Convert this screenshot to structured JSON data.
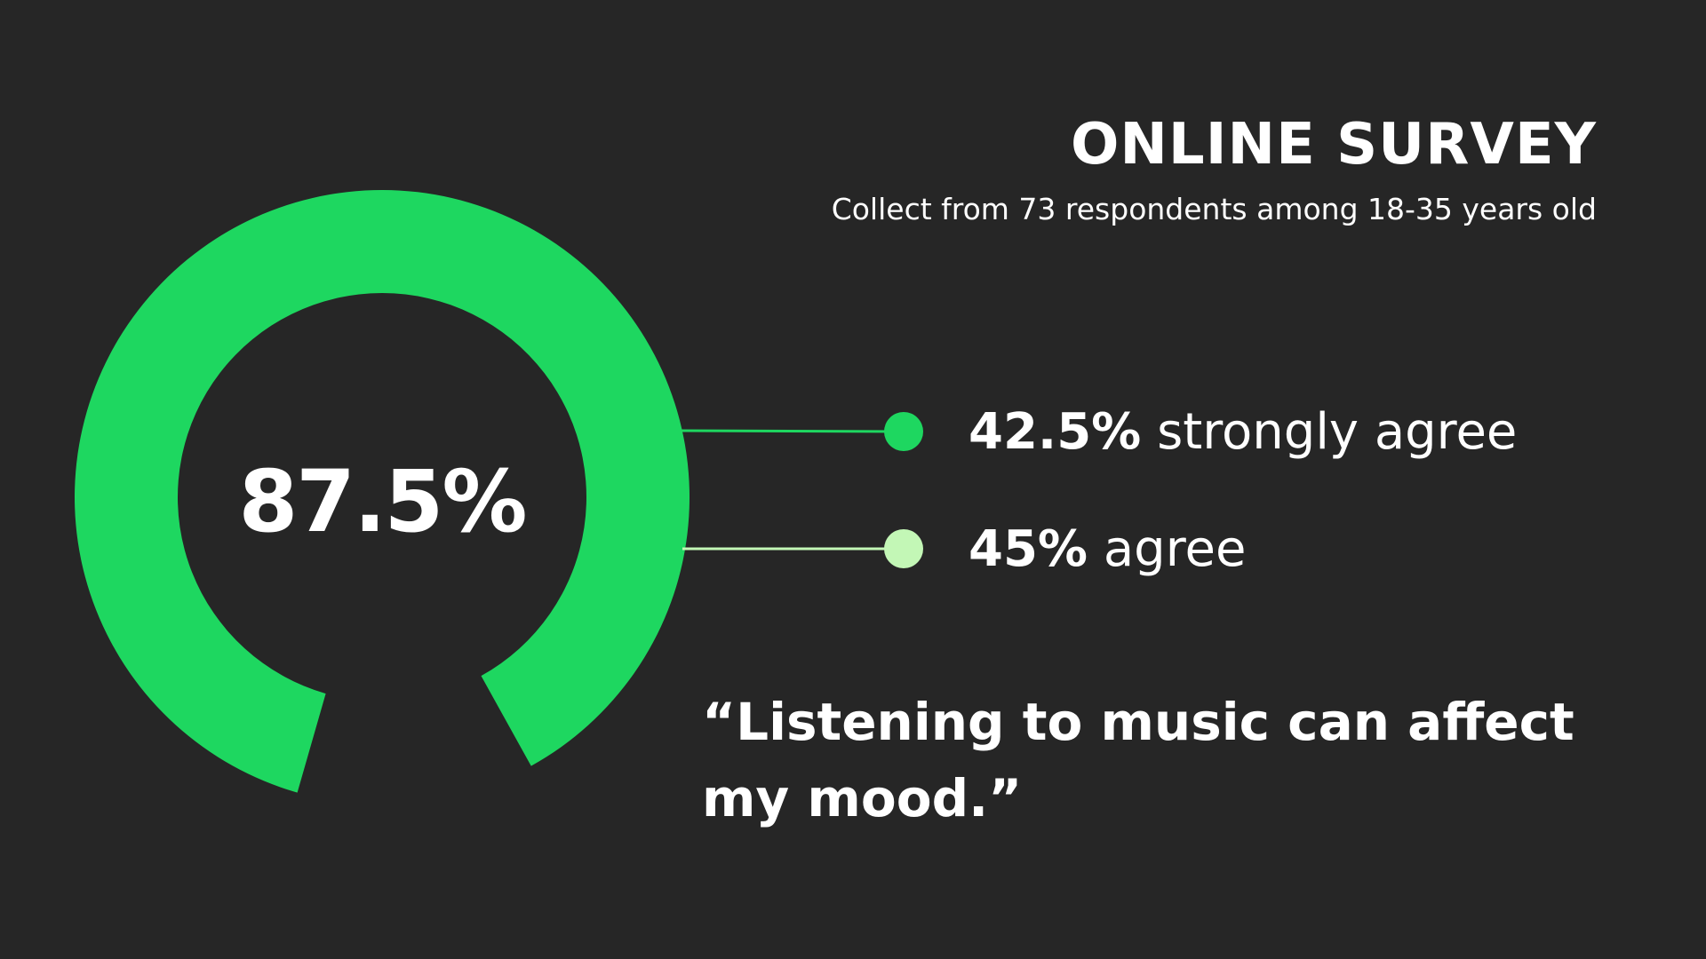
{
  "header": {
    "title": "ONLINE SURVEY",
    "subtitle": "Collect from 73 respondents among 18-35 years old"
  },
  "chart_data": {
    "type": "pie",
    "donut": true,
    "total_label": "87.5%",
    "total_value": 87.5,
    "series": [
      {
        "value": 42.5,
        "label_value": "42.5%",
        "label": "strongly agree",
        "color": "#1ed760"
      },
      {
        "value": 45,
        "label_value": "45%",
        "label": "agree",
        "color": "#c3f7b6"
      }
    ],
    "ring_color": "#1ed760",
    "background_color": "#262626"
  },
  "quote": "“Listening to music can affect my mood.”"
}
